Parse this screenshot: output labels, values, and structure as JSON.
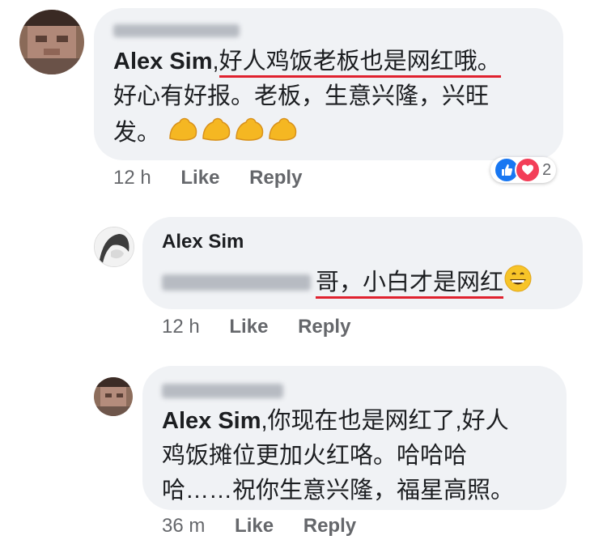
{
  "comments": [
    {
      "author": "Alex Sim",
      "text_prefix": ",",
      "underlined": "好人鸡饭老板也是网红哦。",
      "line2": "好心有好报。老板，生意兴隆，兴旺",
      "line3": "发。",
      "emoji": [
        "flexed-biceps",
        "flexed-biceps",
        "flexed-biceps",
        "flexed-biceps"
      ],
      "time": "12 h",
      "like": "Like",
      "reply": "Reply",
      "reaction_count": "2"
    },
    {
      "author": "Alex Sim",
      "underlined": "哥，小白才是网红",
      "emoji": "grinning-face",
      "time": "12 h",
      "like": "Like",
      "reply": "Reply"
    },
    {
      "author": "Alex Sim",
      "line1": ",你现在也是网红了,好人",
      "line2": "鸡饭摊位更加火红咯。哈哈哈",
      "line3": "哈……祝你生意兴隆，福星高照。",
      "time": "36 m",
      "like": "Like",
      "reply": "Reply"
    }
  ],
  "colors": {
    "bubble": "#f0f2f5",
    "underline": "#e0212e",
    "meta_text": "#65676b",
    "like_blue": "#1877f2",
    "love_red": "#f33e58"
  }
}
